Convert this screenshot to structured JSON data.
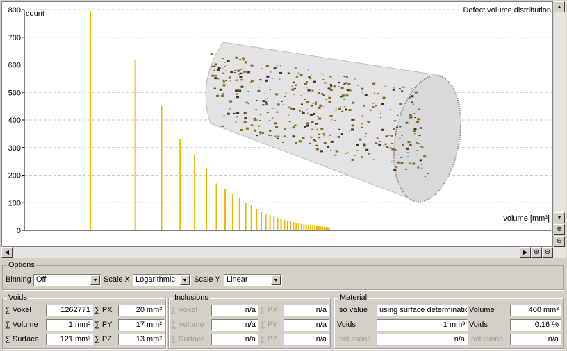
{
  "plot": {
    "title": "Defect volume distribution",
    "ylabel": "count",
    "xlabel": "volume [mm³]"
  },
  "chart_data": {
    "type": "bar",
    "title": "Defect volume distribution",
    "xlabel": "volume [mm³]",
    "ylabel": "count",
    "ylim": [
      0,
      800
    ],
    "yticks": [
      0,
      100,
      200,
      300,
      400,
      500,
      600,
      700,
      800
    ],
    "grid": true,
    "x": [
      1,
      2,
      3,
      4,
      5,
      6,
      7,
      8,
      9,
      10,
      11,
      12,
      13,
      14,
      15,
      16,
      17,
      18,
      19,
      20,
      21,
      22,
      23,
      24,
      25,
      26,
      27,
      28,
      29,
      30,
      31,
      32,
      33,
      34,
      35,
      36,
      37,
      38,
      39,
      40
    ],
    "values": [
      795,
      620,
      450,
      330,
      275,
      225,
      170,
      150,
      130,
      118,
      100,
      90,
      78,
      68,
      60,
      55,
      50,
      46,
      42,
      38,
      35,
      32,
      30,
      28,
      26,
      24,
      22,
      21,
      20,
      19,
      18,
      17,
      16,
      15,
      14,
      14,
      13,
      12,
      12,
      11
    ]
  },
  "icons": {
    "scroll_up": "arrow-up-icon",
    "scroll_down": "arrow-down-icon",
    "scroll_left": "arrow-left-icon",
    "scroll_right": "arrow-right-icon",
    "zoom_in": "zoom-in-icon",
    "zoom_out": "zoom-out-icon"
  },
  "glyphs": {
    "up": "▲",
    "down": "▼",
    "left": "◀",
    "right": "▶",
    "zoom_in": "⊕",
    "zoom_out": "⊖"
  },
  "options": {
    "title": "Options",
    "binning_label": "Binning",
    "binning_value": "Off",
    "scalex_label": "Scale X",
    "scalex_value": "Logarithmic",
    "scaley_label": "Scale Y",
    "scaley_value": "Linear"
  },
  "voids": {
    "title": "Voids",
    "voxel_label": "∑ Voxel",
    "voxel_value": "1262771",
    "volume_label": "∑ Volume",
    "volume_value": "1 mm³",
    "surface_label": "∑ Surface",
    "surface_value": "121 mm²",
    "px_label": "∑ PX",
    "px_value": "20 mm²",
    "py_label": "∑ PY",
    "py_value": "17 mm²",
    "pz_label": "∑ PZ",
    "pz_value": "13 mm²"
  },
  "inclusions": {
    "title": "Inclusions",
    "voxel_label": "∑ Voxel",
    "voxel_value": "n/a",
    "volume_label": "∑ Volume",
    "volume_value": "n/a",
    "surface_label": "∑ Surface",
    "surface_value": "n/a",
    "px_label": "∑ PX",
    "px_value": "n/a",
    "py_label": "∑ PY",
    "py_value": "n/a",
    "pz_label": "∑ PZ",
    "pz_value": "n/a"
  },
  "material": {
    "title": "Material",
    "iso_label": "Iso value",
    "iso_value": "using surface determination",
    "voids_label": "Voids",
    "voids_value": "1 mm³",
    "inclusions_label": "Inclusions",
    "inclusions_value": "n/a",
    "volume_label": "Volume",
    "volume_value": "400 mm³",
    "voids2_label": "Voids",
    "voids2_value": "0.16 %",
    "inclusions2_label": "Inclusions",
    "inclusions2_value": "n/a"
  },
  "colors": {
    "bar": "#f0b400",
    "grid": "#c8c8c8",
    "defect": "#8a6a1a",
    "cylinder": "#e2e2e2"
  }
}
